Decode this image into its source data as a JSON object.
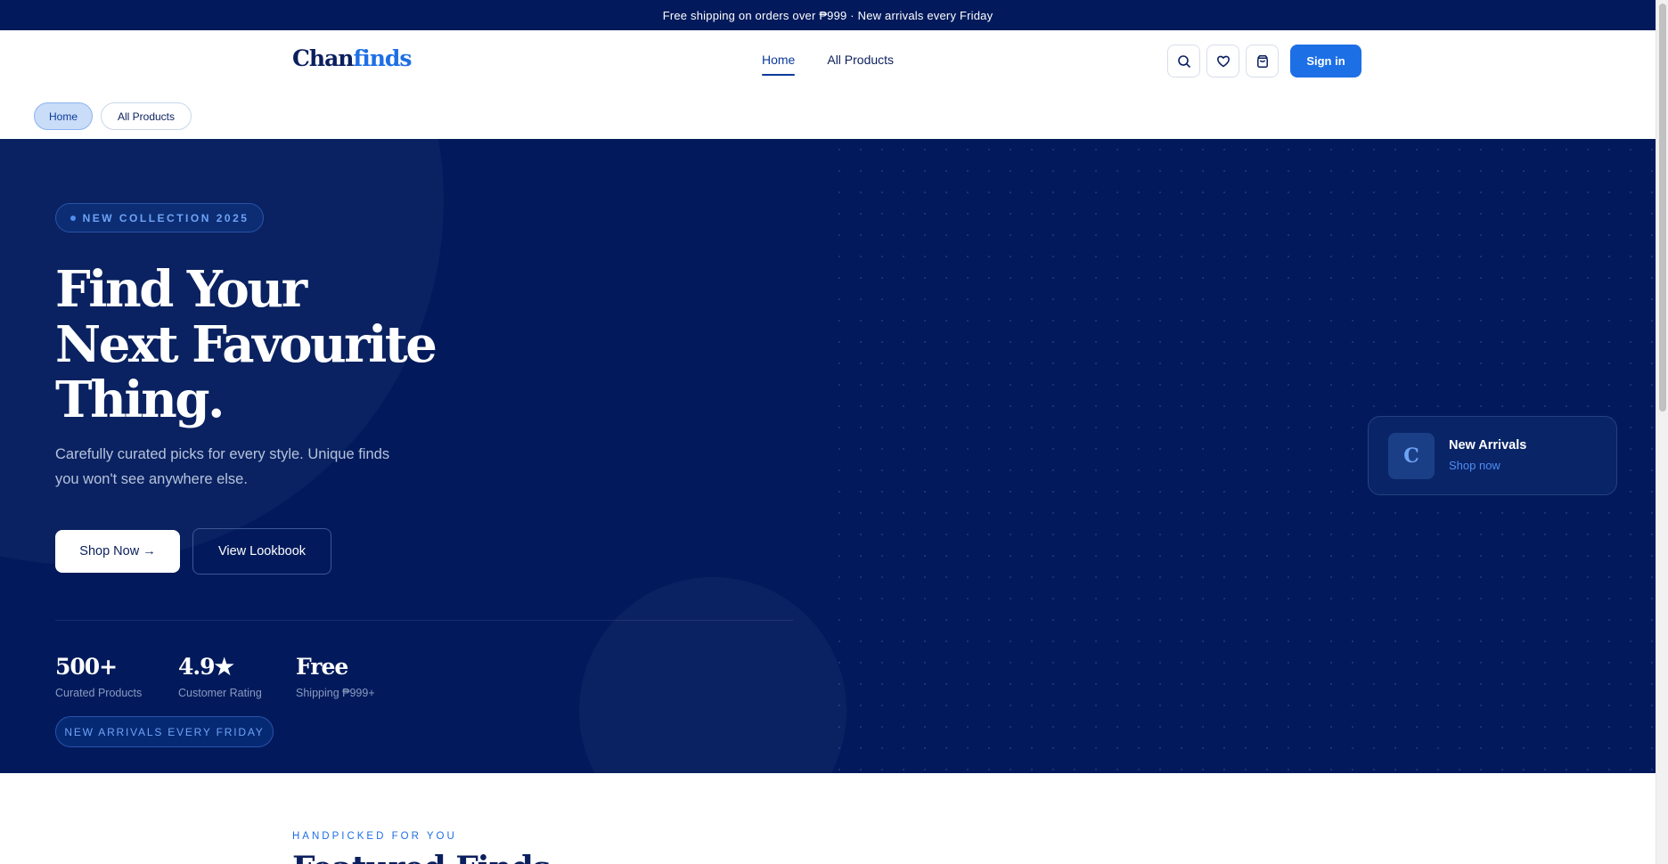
{
  "announcement": {
    "text": "Free shipping on orders over ₱999 · New arrivals every Friday"
  },
  "header": {
    "logo_part1": "Chan",
    "logo_part2": "finds",
    "nav": [
      {
        "label": "Home",
        "active": true
      },
      {
        "label": "All Products",
        "active": false
      }
    ],
    "icons": [
      "search-icon",
      "heart-icon",
      "bag-icon"
    ],
    "signin_label": "Sign in"
  },
  "pills": [
    {
      "label": "Home",
      "active": true
    },
    {
      "label": "All Products",
      "active": false
    }
  ],
  "hero": {
    "badge": "NEW COLLECTION 2025",
    "headline_lines": [
      "Find Your",
      "Next Favourite",
      "Thing."
    ],
    "subtext": "Carefully curated picks for every style. Unique finds you won't see anywhere else.",
    "primary_cta": "Shop Now →",
    "secondary_cta": "View Lookbook",
    "stats": [
      {
        "value": "500+",
        "label": "Curated Products"
      },
      {
        "value": "4.9★",
        "label": "Customer Rating"
      },
      {
        "value": "Free",
        "label": "Shipping ₱999+"
      }
    ],
    "arrivals_badge": "NEW ARRIVALS EVERY FRIDAY",
    "card": {
      "icon_letter": "C",
      "title": "New Arrivals",
      "link": "Shop now"
    }
  },
  "featured": {
    "eyebrow": "HANDPICKED FOR YOU",
    "title": "Featured Finds"
  },
  "colors": {
    "navy": "#021a5c",
    "accent_blue": "#1d6fe6",
    "text_dark": "#0b1f5e"
  }
}
